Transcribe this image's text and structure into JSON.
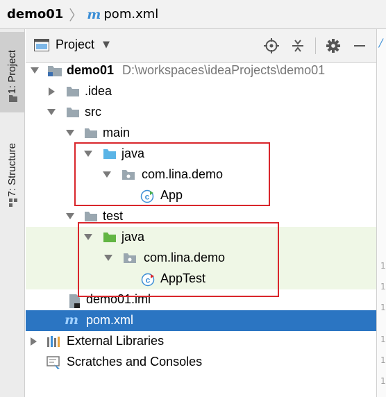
{
  "breadcrumb": {
    "project": "demo01",
    "file": "pom.xml"
  },
  "left_stripe": {
    "project_tab": "1: Project",
    "structure_tab": "7: Structure"
  },
  "header": {
    "title": "Project"
  },
  "tree": {
    "root": {
      "name": "demo01",
      "path": "D:\\workspaces\\ideaProjects\\demo01"
    },
    "idea": ".idea",
    "src": "src",
    "main": "main",
    "main_java": "java",
    "main_pkg": "com.lina.demo",
    "main_class": "App",
    "test": "test",
    "test_java": "java",
    "test_pkg": "com.lina.demo",
    "test_class": "AppTest",
    "iml": "demo01.iml",
    "pom": "pom.xml",
    "external_libraries": "External Libraries",
    "scratches": "Scratches and Consoles"
  },
  "editor": {
    "line_numbers": [
      "1",
      "1",
      "1",
      "1",
      "1",
      "1"
    ]
  },
  "colors": {
    "selection": "#2b75c2",
    "annotation": "#d9262c",
    "test_bg": "#eff7e6",
    "java_source": "#5ab4e6",
    "java_test": "#62b543"
  }
}
